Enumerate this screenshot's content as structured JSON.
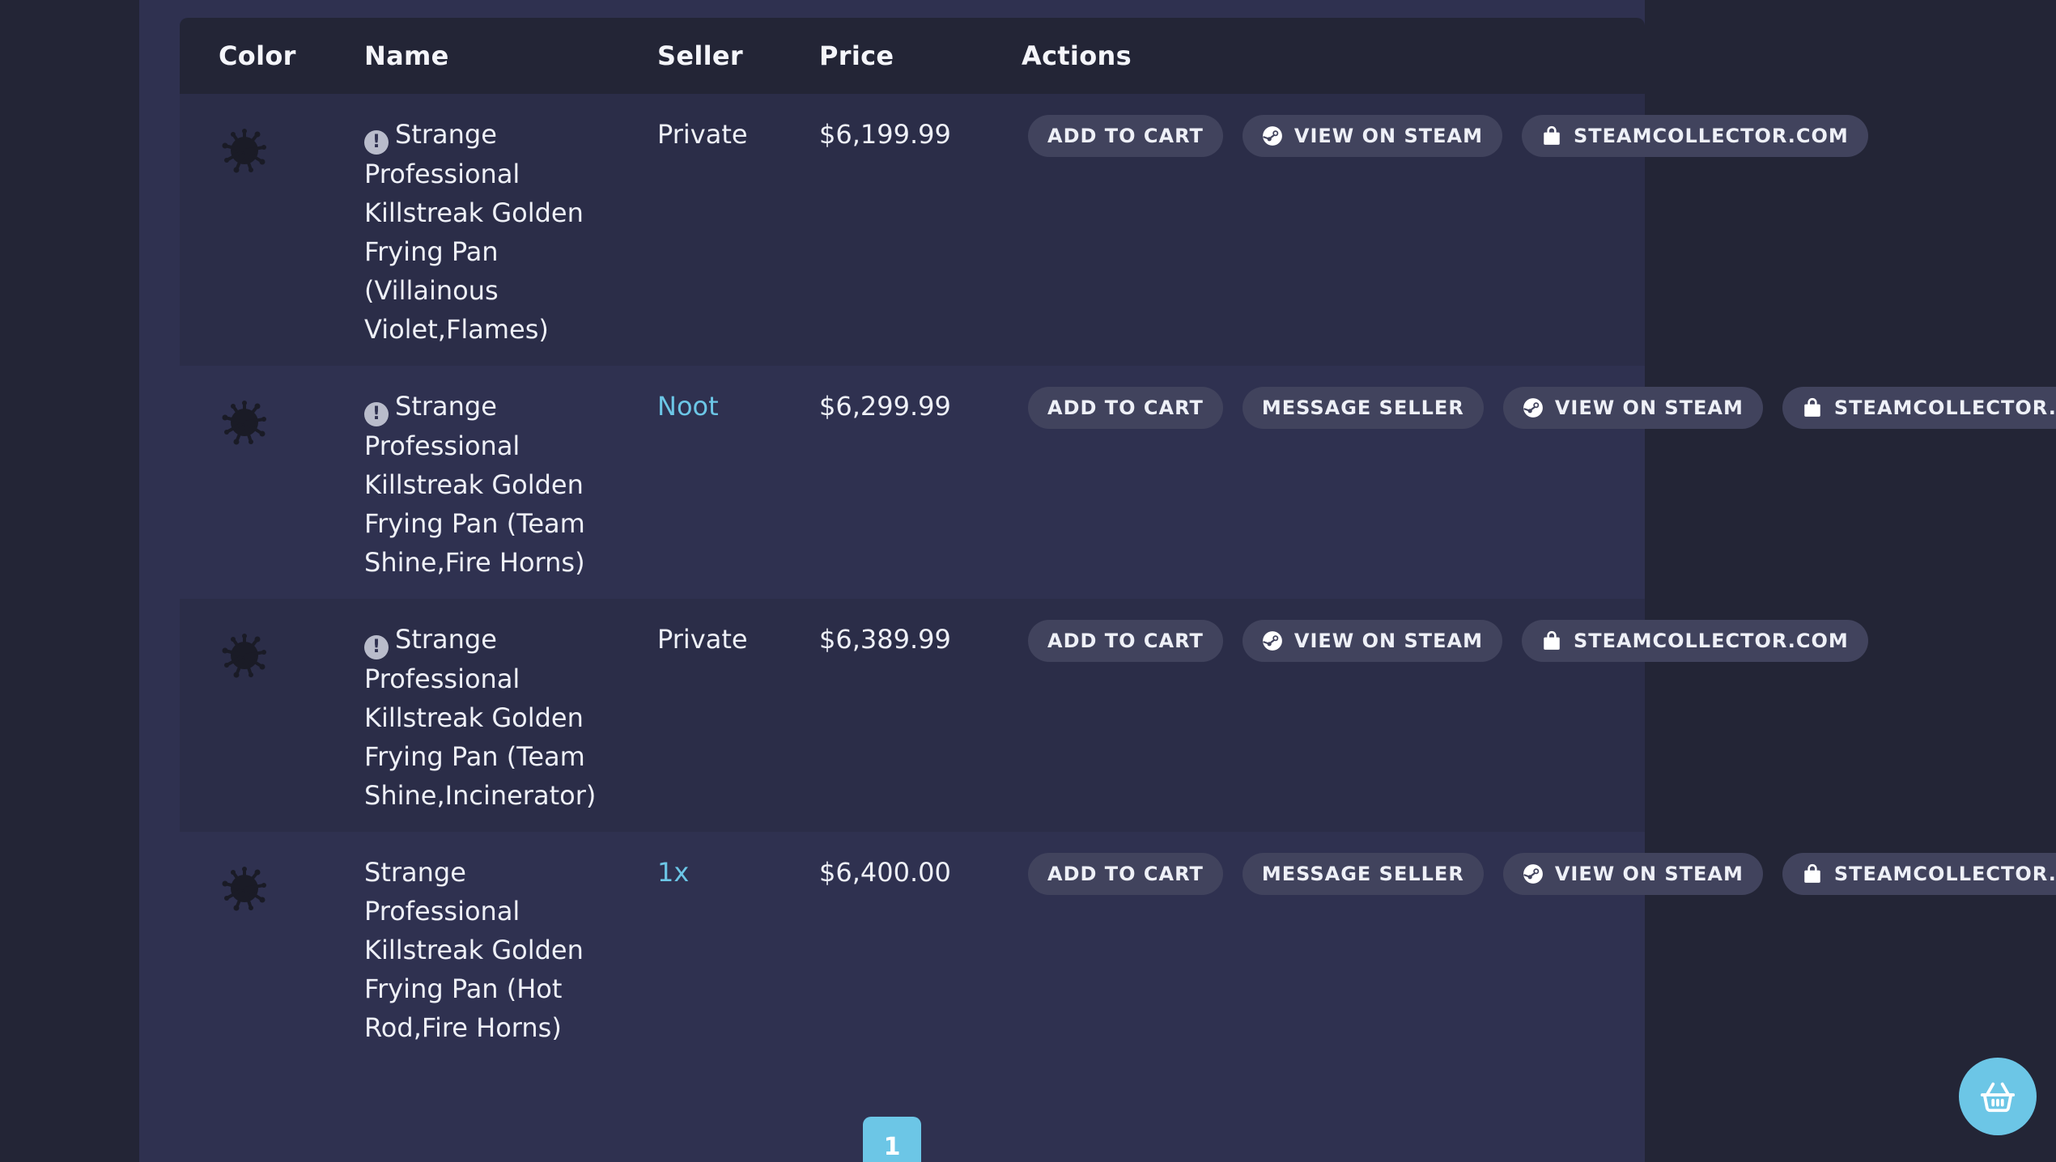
{
  "table": {
    "headers": {
      "color": "Color",
      "name": "Name",
      "seller": "Seller",
      "price": "Price",
      "actions": "Actions"
    },
    "rows": [
      {
        "has_warning_icon": true,
        "name": "Strange Professional Killstreak Golden Frying Pan (Villainous Violet,Flames)",
        "seller": "Private",
        "seller_is_link": false,
        "price": "$6,199.99",
        "actions": [
          "ADD TO CART",
          "VIEW ON STEAM",
          "STEAMCOLLECTOR.COM"
        ]
      },
      {
        "has_warning_icon": true,
        "name": "Strange Professional Killstreak Golden Frying Pan (Team Shine,Fire Horns)",
        "seller": "Noot",
        "seller_is_link": true,
        "price": "$6,299.99",
        "actions": [
          "ADD TO CART",
          "MESSAGE SELLER",
          "VIEW ON STEAM",
          "STEAMCOLLECTOR.COM"
        ]
      },
      {
        "has_warning_icon": true,
        "name": "Strange Professional Killstreak Golden Frying Pan (Team Shine,Incinerator)",
        "seller": "Private",
        "seller_is_link": false,
        "price": "$6,389.99",
        "actions": [
          "ADD TO CART",
          "VIEW ON STEAM",
          "STEAMCOLLECTOR.COM"
        ]
      },
      {
        "has_warning_icon": false,
        "name": "Strange Professional Killstreak Golden Frying Pan (Hot Rod,Fire Horns)",
        "seller": "1x",
        "seller_is_link": true,
        "price": "$6,400.00",
        "actions": [
          "ADD TO CART",
          "MESSAGE SELLER",
          "VIEW ON STEAM",
          "STEAMCOLLECTOR.COM"
        ]
      }
    ]
  },
  "pagination": {
    "current_page": "1"
  },
  "icons": {
    "warning": "exclamation-circle-icon",
    "steam": "steam-icon",
    "shop": "shopping-bag-icon",
    "cart": "basket-icon",
    "paint": "paint-splat-icon"
  },
  "colors": {
    "background": "#232536",
    "panel": "#2f3150",
    "button": "#41435d",
    "accent": "#6cc6e6",
    "paint_splat": "#1a1b26"
  }
}
